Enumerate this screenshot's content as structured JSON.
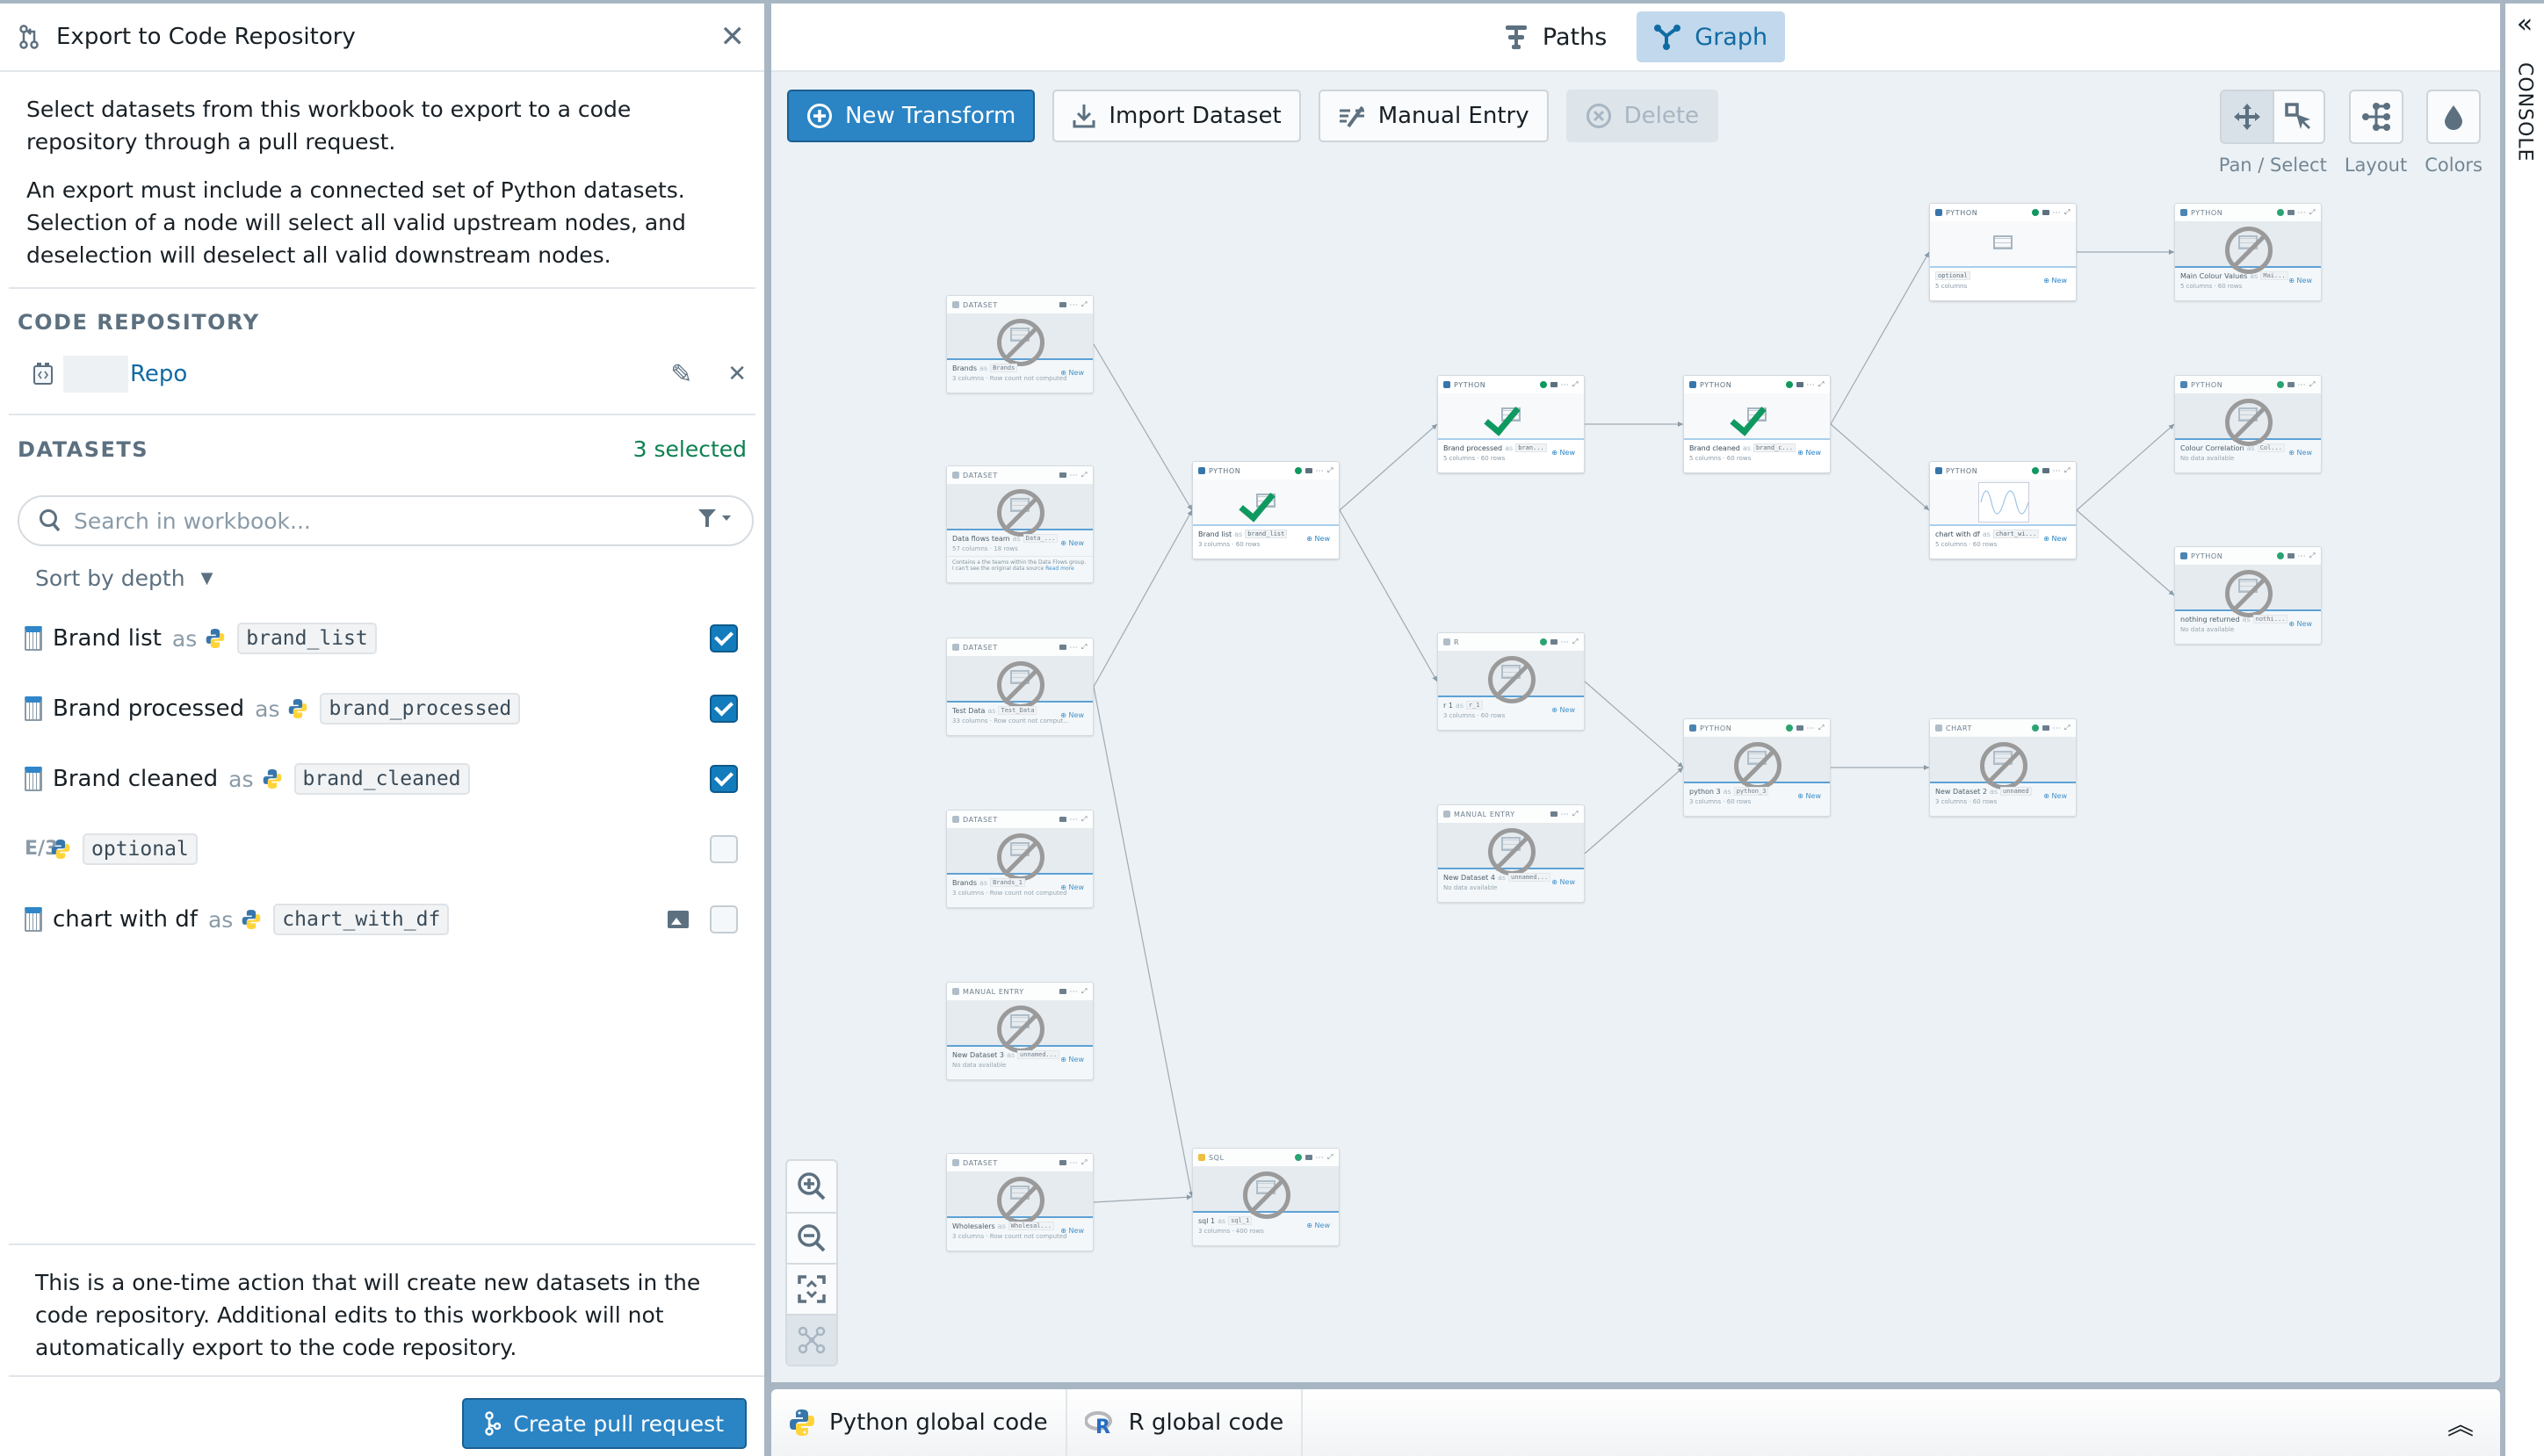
{
  "dialog": {
    "title": "Export to Code Repository",
    "intro_1": "Select datasets from this workbook to export to a code repository through a pull request.",
    "intro_2": "An export must include a connected set of Python datasets. Selection of a node will select all valid upstream nodes, and deselection will deselect all valid downstream nodes.",
    "code_repository_label": "CODE REPOSITORY",
    "repo_name": "Repo",
    "datasets_label": "DATASETS",
    "selected_count": "3 selected",
    "search_placeholder": "Search in workbook...",
    "sort_label": "Sort by depth",
    "as_label": "as",
    "datasets": [
      {
        "name": "Brand list",
        "alias": "brand_list",
        "checked": true,
        "type": "table",
        "has_image": false
      },
      {
        "name": "Brand processed",
        "alias": "brand_processed",
        "checked": true,
        "type": "table",
        "has_image": false
      },
      {
        "name": "Brand cleaned",
        "alias": "brand_cleaned",
        "checked": true,
        "type": "table",
        "has_image": false
      },
      {
        "name": "",
        "alias": "optional",
        "checked": false,
        "type": "object",
        "has_image": false
      },
      {
        "name": "chart with df",
        "alias": "chart_with_df",
        "checked": false,
        "type": "table",
        "has_image": true
      }
    ],
    "footer_text": "This is a one-time action that will create new datasets in the code repository. Additional edits to this workbook will not automatically export to the code repository.",
    "create_pr_label": "Create pull request"
  },
  "view_tabs": [
    {
      "label": "Paths",
      "active": false
    },
    {
      "label": "Graph",
      "active": true
    }
  ],
  "toolbar": {
    "new_transform": "New Transform",
    "import_dataset": "Import Dataset",
    "manual_entry": "Manual Entry",
    "delete": "Delete"
  },
  "right_tools": {
    "pan_select_label": "Pan / Select",
    "layout_label": "Layout",
    "colors_label": "Colors"
  },
  "graph": {
    "new_label": "New",
    "nodes": [
      {
        "id": "brands",
        "type": "DATASET",
        "name": "Brands",
        "alias": "Brands",
        "meta": "3 columns · Row count not computed",
        "status": "none",
        "preview": "blocked"
      },
      {
        "id": "dataflows",
        "type": "DATASET",
        "name": "Data flows team",
        "alias": "Data_...",
        "meta": "57 columns · 18 rows",
        "status": "none",
        "preview": "blocked",
        "description": "Contains a the teams within the Data Flows group. I can't see the original data source",
        "read_more": "Read more"
      },
      {
        "id": "testdata",
        "type": "DATASET",
        "name": "Test Data",
        "alias": "Test_Data",
        "meta": "33 columns · Row count not comput...",
        "status": "none",
        "preview": "blocked"
      },
      {
        "id": "brands1",
        "type": "DATASET",
        "name": "Brands",
        "alias": "Brands_1",
        "meta": "3 columns · Row count not computed",
        "status": "none",
        "preview": "blocked"
      },
      {
        "id": "nd3",
        "type": "MANUAL ENTRY",
        "name": "New Dataset 3",
        "alias": "unnamed...",
        "meta": "No data available",
        "status": "none",
        "preview": "blocked"
      },
      {
        "id": "wholesalers",
        "type": "DATASET",
        "name": "Wholesalers",
        "alias": "Wholesal...",
        "meta": "3 columns · Row count not computed",
        "status": "none",
        "preview": "blocked"
      },
      {
        "id": "brandlist",
        "type": "PYTHON",
        "name": "Brand list",
        "alias": "brand_list",
        "meta": "3 columns · 60 rows",
        "status": "ok",
        "preview": "check"
      },
      {
        "id": "sql1",
        "type": "SQL",
        "name": "sql 1",
        "alias": "sql_1",
        "meta": "3 columns · 400 rows",
        "status": "ok",
        "preview": "blocked"
      },
      {
        "id": "brandproc",
        "type": "PYTHON",
        "name": "Brand processed",
        "alias": "bran...",
        "meta": "5 columns · 60 rows",
        "status": "ok",
        "preview": "check"
      },
      {
        "id": "r1",
        "type": "R",
        "name": "r 1",
        "alias": "r_1",
        "meta": "3 columns · 60 rows",
        "status": "ok",
        "preview": "blocked"
      },
      {
        "id": "nd4",
        "type": "MANUAL ENTRY",
        "name": "New Dataset 4",
        "alias": "unnamed...",
        "meta": "No data available",
        "status": "none",
        "preview": "blocked"
      },
      {
        "id": "brandclean",
        "type": "PYTHON",
        "name": "Brand cleaned",
        "alias": "brand_c...",
        "meta": "5 columns · 60 rows",
        "status": "ok",
        "preview": "check"
      },
      {
        "id": "python3",
        "type": "PYTHON",
        "name": "python 3",
        "alias": "python_3",
        "meta": "3 columns · 60 rows",
        "status": "ok",
        "preview": "blocked"
      },
      {
        "id": "optional",
        "type": "PYTHON",
        "name": "",
        "alias": "optional",
        "meta": "5 columns",
        "status": "ok",
        "preview": "grid"
      },
      {
        "id": "chartdf",
        "type": "PYTHON",
        "name": "chart with df",
        "alias": "chart_wi...",
        "meta": "5 columns · 60 rows",
        "status": "ok",
        "preview": "chart"
      },
      {
        "id": "nd2",
        "type": "CHART",
        "name": "New Dataset 2",
        "alias": "unnamed",
        "meta": "3 columns · 60 rows",
        "status": "ok",
        "preview": "blocked"
      },
      {
        "id": "maincolour",
        "type": "PYTHON",
        "name": "Main Colour Values",
        "alias": "Mai...",
        "meta": "5 columns · 60 rows",
        "status": "ok",
        "preview": "blocked"
      },
      {
        "id": "colourcorr",
        "type": "PYTHON",
        "name": "Colour Correlation",
        "alias": "Col...",
        "meta": "No data available",
        "status": "ok",
        "preview": "blocked"
      },
      {
        "id": "nothing",
        "type": "PYTHON",
        "name": "nothing returned",
        "alias": "nothi...",
        "meta": "No data available",
        "status": "ok",
        "preview": "blocked"
      }
    ],
    "edges": [
      [
        "brands",
        "brandlist"
      ],
      [
        "testdata",
        "brandlist"
      ],
      [
        "brandlist",
        "brandproc"
      ],
      [
        "brandlist",
        "r1"
      ],
      [
        "brandproc",
        "brandclean"
      ],
      [
        "brandclean",
        "optional"
      ],
      [
        "brandclean",
        "chartdf"
      ],
      [
        "optional",
        "maincolour"
      ],
      [
        "chartdf",
        "colourcorr"
      ],
      [
        "chartdf",
        "nothing"
      ],
      [
        "r1",
        "python3"
      ],
      [
        "nd4",
        "python3"
      ],
      [
        "python3",
        "nd2"
      ],
      [
        "testdata",
        "sql1"
      ],
      [
        "wholesalers",
        "sql1"
      ]
    ]
  },
  "bottom_tabs": [
    {
      "label": "Python global code",
      "icon": "python-icon"
    },
    {
      "label": "R global code",
      "icon": "r-icon"
    }
  ],
  "console_label": "CONSOLE"
}
